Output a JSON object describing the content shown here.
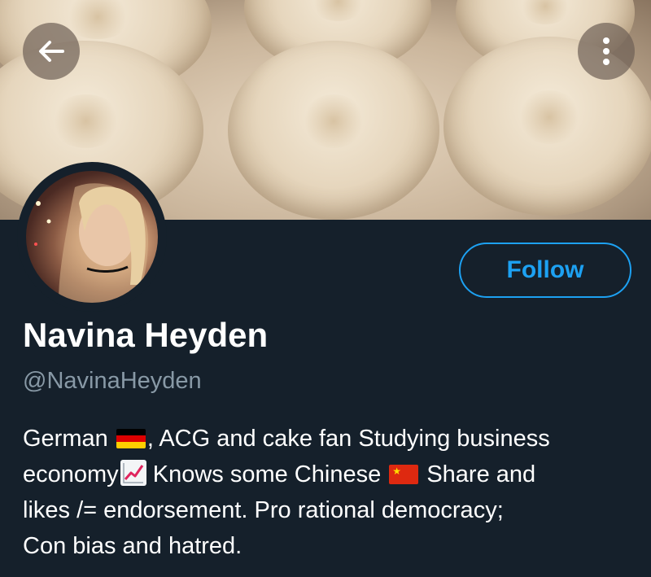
{
  "header": {
    "back_icon": "arrow-left-icon",
    "more_icon": "more-vertical-icon"
  },
  "profile": {
    "display_name": "Navina Heyden",
    "handle": "@NavinaHeyden",
    "follow_label": "Follow",
    "accent_color": "#1da1f2",
    "bio": {
      "line1_a": "German",
      "line1_flag": "germany-flag-icon",
      "line1_b": ", ACG and cake fan Studying business",
      "line2_a": "economy",
      "line2_emoji": "chart-increasing-icon",
      "line2_b": " Knows some Chinese",
      "line2_flag": "china-flag-icon",
      "line2_c": " Share and",
      "line3": "likes /= endorsement.  Pro rational democracy;",
      "line4": "Con bias and hatred."
    }
  }
}
